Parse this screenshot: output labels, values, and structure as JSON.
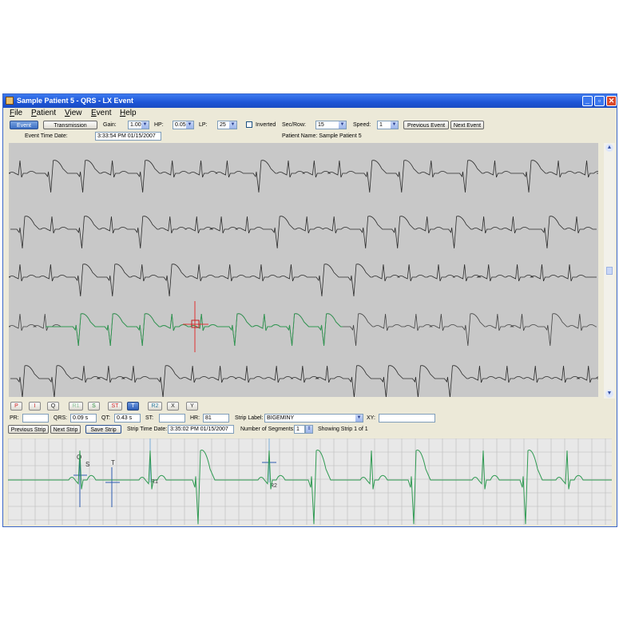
{
  "window": {
    "title": "Sample Patient 5 - QRS - LX Event",
    "controls": [
      "_",
      "▫",
      "✕"
    ]
  },
  "menu": [
    {
      "first": "F",
      "rest": "ile"
    },
    {
      "first": "P",
      "rest": "atient"
    },
    {
      "first": "V",
      "rest": "iew"
    },
    {
      "first": "E",
      "rest": "vent"
    },
    {
      "first": "H",
      "rest": "elp"
    }
  ],
  "toolbar": {
    "event_label": "Event",
    "transmission_label": "Transmission",
    "gain_label": "Gain:",
    "gain_value": "1.00",
    "hp_label": "HP:",
    "hp_value": "0.05",
    "lp_label": "LP:",
    "lp_value": "25",
    "inverted_label": "Inverted",
    "inverted_checked": false,
    "secrow_label": "Sec/Row:",
    "secrow_value": "15",
    "speed_label": "Speed:",
    "speed_value": "1",
    "prev_event_label": "Previous Event",
    "next_event_label": "Next Event",
    "event_time_label": "Event Time Date:",
    "event_time_value": "3:33:54 PM 01/15/2007",
    "patient_name": "Patient Name: Sample Patient 5"
  },
  "annotations": {
    "buttons": [
      {
        "label": "P",
        "color": "#cc2222",
        "active": false
      },
      {
        "label": "I",
        "color": "#cc2222",
        "active": false
      },
      {
        "label": "Q",
        "color": "#222222",
        "active": false
      },
      {
        "label": "R1",
        "color": "#8fc49a",
        "active": false
      },
      {
        "label": "S",
        "color": "#2a8a3a",
        "active": false
      },
      {
        "label": "ST",
        "color": "#cc2222",
        "active": false
      },
      {
        "label": "T",
        "color": "#ffffff",
        "active": true
      },
      {
        "label": "R2",
        "color": "#2a7a9a",
        "active": false
      },
      {
        "label": "X",
        "color": "#222222",
        "active": false
      },
      {
        "label": "Y",
        "color": "#222222",
        "active": false
      }
    ],
    "pr_label": "PR:",
    "pr_value": "",
    "qrs_label": "QRS:",
    "qrs_value": "0.09 s",
    "qt_label": "QT:",
    "qt_value": "0.43 s",
    "st_label": "ST:",
    "st_value": "",
    "hr_label": "HR:",
    "hr_value": "81",
    "strip_label_label": "Strip Label:",
    "strip_label_value": "BIGEMINY",
    "xy_label": "XY:",
    "xy_value": ""
  },
  "strip": {
    "prev_label": "Previous Strip",
    "next_label": "Next Strip",
    "save_label": "Save Strip",
    "time_label": "Strip Time Date:",
    "time_value": "3:35:02 PM 01/15/2007",
    "segments_label": "Number of Segments:",
    "segments_value": "1",
    "showing": "Showing Strip 1 of 1",
    "markers": {
      "q": "Q",
      "s": "S",
      "t": "T",
      "r1": "R1",
      "r2": "R2"
    }
  },
  "colors": {
    "trace": "#2b2b2b",
    "selection": "#2f9a52",
    "cursor": "#e03030",
    "marker": "#2e5db0"
  }
}
